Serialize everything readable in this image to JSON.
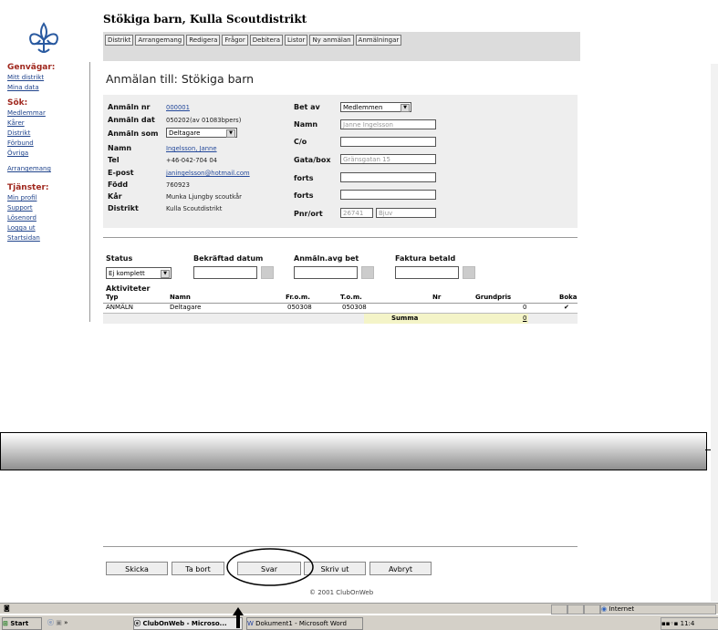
{
  "site": {
    "title": "Stökiga barn, Kulla Scoutdistrikt"
  },
  "menu": [
    "Distrikt",
    "Arrangemang",
    "Redigera",
    "Frågor",
    "Debitera",
    "Listor",
    "Ny anmälan",
    "Anmälningar"
  ],
  "nav": {
    "shortcuts_heading": "Genvägar:",
    "shortcuts": [
      "Mitt distrikt",
      "Mina data"
    ],
    "search_heading": "Sök:",
    "search": [
      "Medlemmar",
      "Kårer",
      "Distrikt",
      "Förbund",
      "Övriga"
    ],
    "events": "Arrangemang",
    "services_heading": "Tjänster:",
    "services": [
      "Min profil",
      "Support",
      "Lösenord",
      "Logga ut",
      "Startsidan"
    ]
  },
  "page": {
    "heading": "Anmälan till: Stökiga barn"
  },
  "form": {
    "labels": {
      "nr": "Anmäln nr",
      "dat": "Anmäln dat",
      "som": "Anmäln som",
      "namn": "Namn",
      "tel": "Tel",
      "epost": "E-post",
      "fodd": "Född",
      "kar": "Kår",
      "distrikt": "Distrikt",
      "betav": "Bet av",
      "namn2": "Namn",
      "co": "C/o",
      "gata": "Gata/box",
      "forts1": "forts",
      "forts2": "forts",
      "pnr": "Pnr/ort"
    },
    "values": {
      "nr": "000001",
      "dat": "050202(av 01083bpers)",
      "som": "Deltagare",
      "namn": "Ingelsson, Janne",
      "tel": "+46-042-704 04",
      "epost": "janingelsson@hotmail.com",
      "fodd": "760923",
      "kar": "Munka Ljungby scoutkår",
      "distrikt": "Kulla Scoutdistrikt",
      "betav": "Medlemmen",
      "namn2": "Janne Ingelsson",
      "gata": "Gränsgatan 15",
      "pnr": "26741",
      "ort": "Bjuv"
    }
  },
  "status": {
    "status_label": "Status",
    "status_value": "Ej komplett",
    "bekraftad": "Bekräftad datum",
    "anmbet": "Anmäln.avg bet",
    "faktura": "Faktura betald"
  },
  "table": {
    "caption": "Aktiviteter",
    "headers": [
      "Typ",
      "Namn",
      "Fr.o.m.",
      "T.o.m.",
      "Nr",
      "Grundpris",
      "Boka"
    ],
    "row": [
      "ANMÄLN",
      "Deltagare",
      "050308",
      "050308",
      "",
      "0",
      "✔"
    ],
    "summa_label": "Summa",
    "summa_value": "0"
  },
  "buttons": [
    "Skicka",
    "Ta bort",
    "Svar",
    "Skriv ut",
    "Avbryt"
  ],
  "footer": "© 2001 ClubOnWeb",
  "statusbar": {
    "zone": "Internet"
  },
  "taskbar": {
    "start": "Start",
    "item1": "ClubOnWeb - Microso...",
    "item2": "Dokument1 - Microsoft Word",
    "clock": "11:4"
  },
  "colors": {
    "nav_heading": "#a0281e",
    "link": "#20448c",
    "summa_bg": "#f4f4c8"
  }
}
